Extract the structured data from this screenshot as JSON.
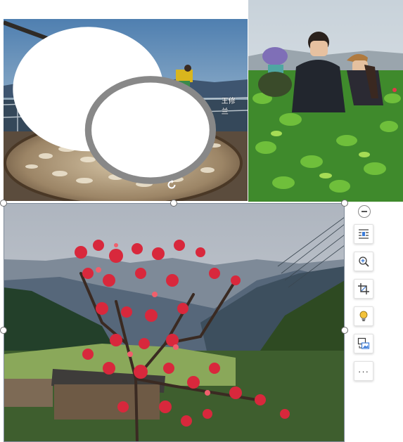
{
  "photos": [
    {
      "name": "drying-tray-photo",
      "description_icon": "image"
    },
    {
      "name": "tea-picking-photo",
      "description_icon": "image"
    },
    {
      "name": "red-tree-photo",
      "description_icon": "image"
    }
  ],
  "watermark": {
    "text": "王修兰",
    "icon": "wechat-icon"
  },
  "rotate_handle": {
    "icon": "rotate-icon"
  },
  "toolbar": {
    "collapse_icon": "minus-circle-icon",
    "buttons": [
      {
        "name": "layout-options-button",
        "icon": "text-wrap-icon"
      },
      {
        "name": "zoom-button",
        "icon": "zoom-in-icon"
      },
      {
        "name": "crop-button",
        "icon": "crop-icon"
      },
      {
        "name": "smart-tips-button",
        "icon": "lightbulb-icon"
      },
      {
        "name": "replace-image-button",
        "icon": "image-replace-icon"
      },
      {
        "name": "more-button",
        "icon": "more-icon",
        "label": "···"
      }
    ]
  },
  "colors": {
    "accent_red": "#d8283c",
    "handle_border": "#6c6c6c",
    "frame": "#7f8b99"
  }
}
